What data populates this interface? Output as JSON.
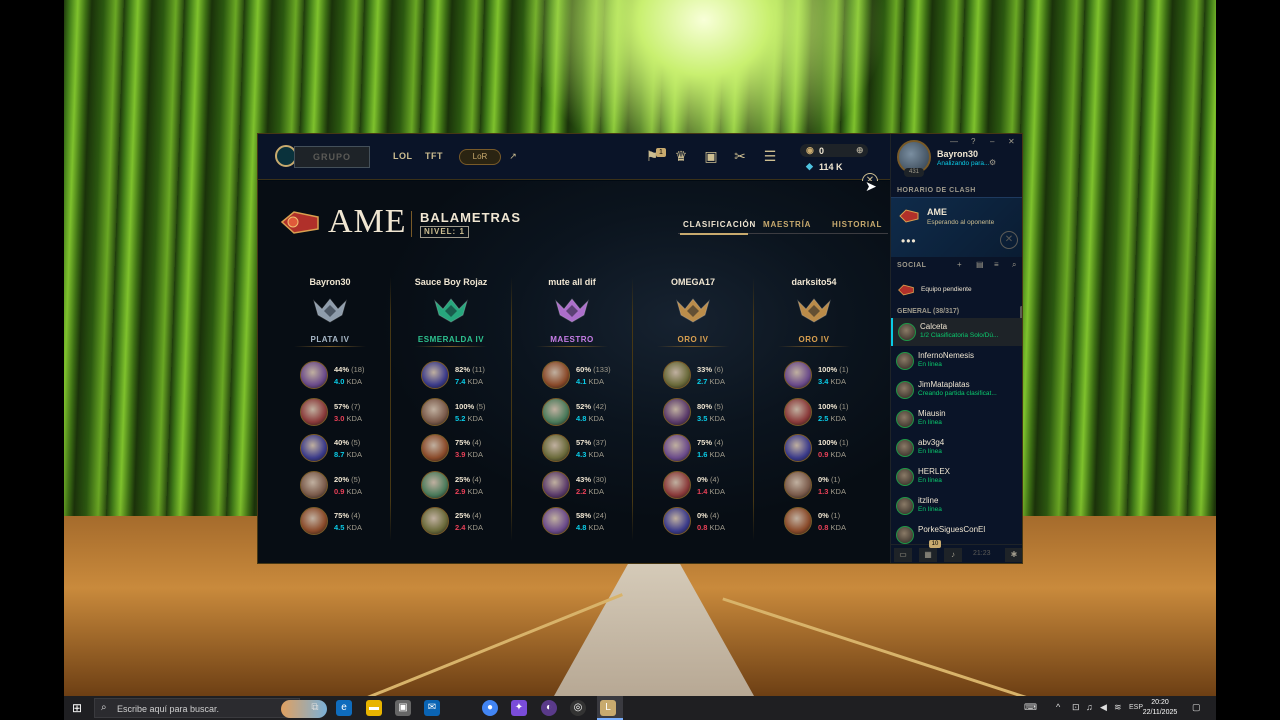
{
  "topbar": {
    "play_label": "GRUPO",
    "nav": [
      "LOL",
      "TFT"
    ],
    "lor_label": "LoR",
    "notification_count": "1",
    "rp": "0",
    "be": "114 K"
  },
  "clash": {
    "tag": "AME",
    "team_name": "BALAMETRAS",
    "level": "NIVEL: 1",
    "tabs": [
      "CLASIFICACIÓN",
      "MAESTRÍA",
      "HISTORIAL"
    ],
    "players": [
      {
        "name": "Bayron30",
        "rank": "PLATA IV",
        "rank_color": "#a7b7c7",
        "champs": [
          {
            "wr": "44%",
            "games": "(18)",
            "kda": "4.0",
            "good": true
          },
          {
            "wr": "57%",
            "games": "(7)",
            "kda": "3.0",
            "good": false
          },
          {
            "wr": "40%",
            "games": "(5)",
            "kda": "8.7",
            "good": true
          },
          {
            "wr": "20%",
            "games": "(5)",
            "kda": "0.9",
            "good": false
          },
          {
            "wr": "75%",
            "games": "(4)",
            "kda": "4.5",
            "good": true
          }
        ]
      },
      {
        "name": "Sauce Boy Rojaz",
        "rank": "ESMERALDA IV",
        "rank_color": "#2dc28f",
        "champs": [
          {
            "wr": "82%",
            "games": "(11)",
            "kda": "7.4",
            "good": true
          },
          {
            "wr": "100%",
            "games": "(5)",
            "kda": "5.2",
            "good": true
          },
          {
            "wr": "75%",
            "games": "(4)",
            "kda": "3.9",
            "good": false
          },
          {
            "wr": "25%",
            "games": "(4)",
            "kda": "2.9",
            "good": false
          },
          {
            "wr": "25%",
            "games": "(4)",
            "kda": "2.4",
            "good": false
          }
        ]
      },
      {
        "name": "mute all dif",
        "rank": "MAESTRO",
        "rank_color": "#c87ee8",
        "champs": [
          {
            "wr": "60%",
            "games": "(133)",
            "kda": "4.1",
            "good": true
          },
          {
            "wr": "52%",
            "games": "(42)",
            "kda": "4.8",
            "good": true
          },
          {
            "wr": "57%",
            "games": "(37)",
            "kda": "4.3",
            "good": true
          },
          {
            "wr": "43%",
            "games": "(30)",
            "kda": "2.2",
            "good": false
          },
          {
            "wr": "58%",
            "games": "(24)",
            "kda": "4.8",
            "good": true
          }
        ]
      },
      {
        "name": "OMEGA17",
        "rank": "ORO IV",
        "rank_color": "#d9a050",
        "champs": [
          {
            "wr": "33%",
            "games": "(6)",
            "kda": "2.7",
            "good": true
          },
          {
            "wr": "80%",
            "games": "(5)",
            "kda": "3.5",
            "good": true
          },
          {
            "wr": "75%",
            "games": "(4)",
            "kda": "1.6",
            "good": true
          },
          {
            "wr": "0%",
            "games": "(4)",
            "kda": "1.4",
            "good": false
          },
          {
            "wr": "0%",
            "games": "(4)",
            "kda": "0.8",
            "good": false
          }
        ]
      },
      {
        "name": "darksito54",
        "rank": "ORO IV",
        "rank_color": "#d9a050",
        "champs": [
          {
            "wr": "100%",
            "games": "(1)",
            "kda": "3.4",
            "good": true
          },
          {
            "wr": "100%",
            "games": "(1)",
            "kda": "2.5",
            "good": true
          },
          {
            "wr": "100%",
            "games": "(1)",
            "kda": "0.9",
            "good": false
          },
          {
            "wr": "0%",
            "games": "(1)",
            "kda": "1.3",
            "good": false
          },
          {
            "wr": "0%",
            "games": "(1)",
            "kda": "0.8",
            "good": false
          }
        ]
      }
    ],
    "kda_label": "KDA"
  },
  "side": {
    "name": "Bayron30",
    "status": "Analizando para...",
    "level": "431",
    "clash_header": "HORARIO DE CLASH",
    "clash_tag": "AME",
    "clash_sub": "Esperando al oponente",
    "clash_dots": "•••",
    "social_header": "SOCIAL",
    "pending": "Equipo pendiente",
    "group": "GENERAL (38/317)",
    "friends": [
      {
        "name": "Calceta",
        "status": "1/2 Clasificatoria Solo/Dú..."
      },
      {
        "name": "InfernoNemesis",
        "status": "En línea"
      },
      {
        "name": "JimMataplatas",
        "status": "Creando partida clasificat..."
      },
      {
        "name": "Miausin",
        "status": "En línea"
      },
      {
        "name": "abv3g4",
        "status": "En línea"
      },
      {
        "name": "HERLEX",
        "status": "En línea"
      },
      {
        "name": "itzline",
        "status": "En línea"
      },
      {
        "name": "PorkeSiguesConEl",
        "status": ""
      }
    ],
    "bottom_badge": "10",
    "bottom_time": "21:23"
  },
  "taskbar": {
    "search_placeholder": "Escribe aquí para buscar.",
    "lang": "ESP",
    "time": "20:20",
    "date": "22/11/2025"
  }
}
